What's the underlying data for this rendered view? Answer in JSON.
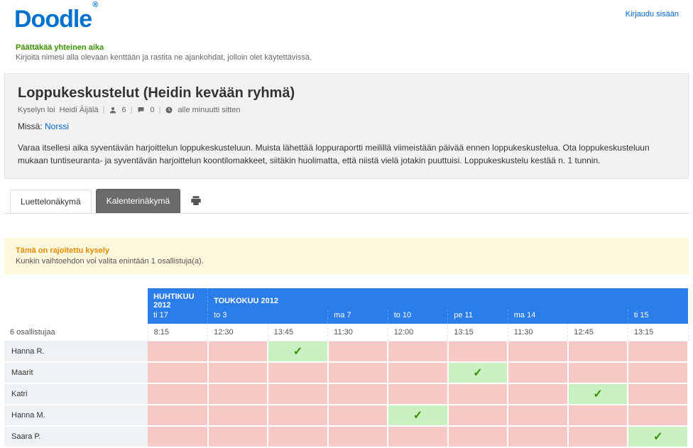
{
  "header": {
    "brand": "Doodle",
    "brand_reg": "®",
    "login": "Kirjaudu sisään"
  },
  "intro": {
    "title": "Päättäkää yhteinen aika",
    "sub": "Kirjoita nimesi alla olevaan kenttään ja rastita ne ajankohdat, jolloin olet käytettävissä."
  },
  "poll": {
    "title": "Loppukeskustelut (Heidin kevään ryhmä)",
    "created_by_prefix": "Kyselyn loi",
    "created_by": "Heidi Äijälä",
    "participants": "6",
    "comments": "0",
    "time_ago": "alle minuutti sitten",
    "where_label": "Missä:",
    "where_value": "Norssi",
    "description": "Varaa itsellesi aika syventävän harjoittelun loppukeskusteluun. Muista lähettää loppuraportti meilillä viimeistään päivää ennen loppukeskustelua. Ota loppukeskusteluun mukaan tuntiseuranta- ja syventävän harjoittelun koontilomakkeet, siitäkin huolimatta, että niistä vielä jotakin puuttuisi. Loppukeskustelu kestää n. 1 tunnin."
  },
  "tabs": {
    "list": "Luettelonäkymä",
    "calendar": "Kalenterinäkymä"
  },
  "warning": {
    "title": "Tämä on rajoitettu kysely",
    "sub": "Kunkin vaihtoehdon voi valita enintään 1 osallistuja(a)."
  },
  "schedule": {
    "participants_count_label": "6 osallistujaa",
    "months": [
      {
        "label": "HUHTIKUU 2012",
        "span": 1
      },
      {
        "label": "TOUKOKUU 2012",
        "span": 8
      }
    ],
    "days": [
      {
        "label": "ti 17",
        "span": 1
      },
      {
        "label": "to 3",
        "span": 2
      },
      {
        "label": "ma 7",
        "span": 1
      },
      {
        "label": "to 10",
        "span": 1
      },
      {
        "label": "pe 11",
        "span": 1
      },
      {
        "label": "ma 14",
        "span": 2
      },
      {
        "label": "ti 15",
        "span": 1
      }
    ],
    "times": [
      "8:15",
      "12:30",
      "13:45",
      "11:30",
      "12:00",
      "13:15",
      "11:30",
      "12:45",
      "13:15"
    ],
    "rows": [
      {
        "name": "Hanna R.",
        "cells": [
          "no",
          "no",
          "yes",
          "no",
          "no",
          "no",
          "no",
          "no",
          "no"
        ]
      },
      {
        "name": "Maarit",
        "cells": [
          "no",
          "no",
          "no",
          "no",
          "no",
          "yes",
          "no",
          "no",
          "no"
        ]
      },
      {
        "name": "Katri",
        "cells": [
          "no",
          "no",
          "no",
          "no",
          "no",
          "no",
          "no",
          "yes",
          "no"
        ]
      },
      {
        "name": "Hanna M.",
        "cells": [
          "no",
          "no",
          "no",
          "no",
          "yes",
          "no",
          "no",
          "no",
          "no"
        ]
      },
      {
        "name": "Saara P.",
        "cells": [
          "no",
          "no",
          "no",
          "no",
          "no",
          "no",
          "no",
          "no",
          "yes"
        ]
      }
    ]
  }
}
